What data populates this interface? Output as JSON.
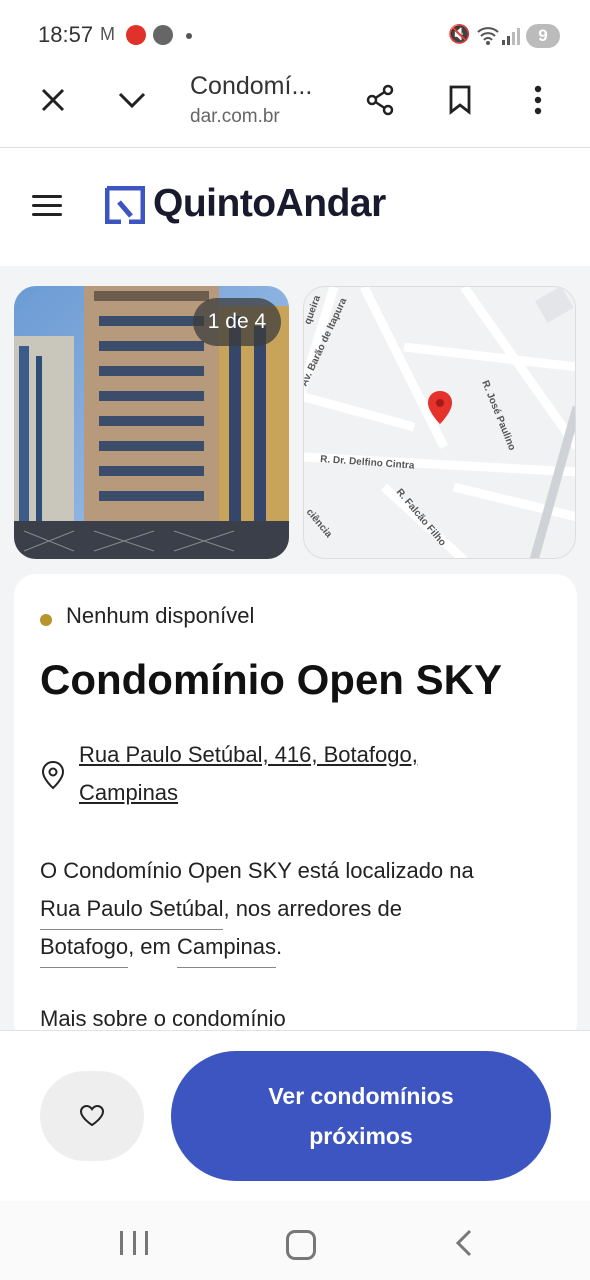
{
  "status_bar": {
    "time": "18:57",
    "notifications": [
      "mail-icon",
      "app-icon",
      "chrome-icon"
    ],
    "battery_level": "9"
  },
  "browser": {
    "page_title": "Condomí...",
    "url": "dar.com.br"
  },
  "site": {
    "brand_name": "QuintoAndar",
    "brand_color": "#3d55c0"
  },
  "gallery": {
    "counter": "1 de 4"
  },
  "map": {
    "streets": [
      "Av. Barão de Itapura",
      "R. José Paulino",
      "R. Dr. Delfino Cintra",
      "R. Falcão Filho",
      "ciência",
      "queira"
    ]
  },
  "listing": {
    "availability": "Nenhum disponível",
    "availability_color": "#b8952c",
    "title": "Condomínio Open SKY",
    "address_line1": "Rua Paulo Setúbal, 416, Botafogo,",
    "address_line2": "Campinas",
    "description": {
      "p1": "O Condomínio Open SKY está localizado na",
      "street_link": "Rua Paulo Setúbal",
      "p2": ", nos arredores de",
      "neighborhood_link": "Botafogo",
      "p3": ", em ",
      "city_link": "Campinas",
      "p4": "."
    },
    "more_about": "Mais sobre o condomínio"
  },
  "actions": {
    "cta_label": "Ver condomínios próximos"
  }
}
